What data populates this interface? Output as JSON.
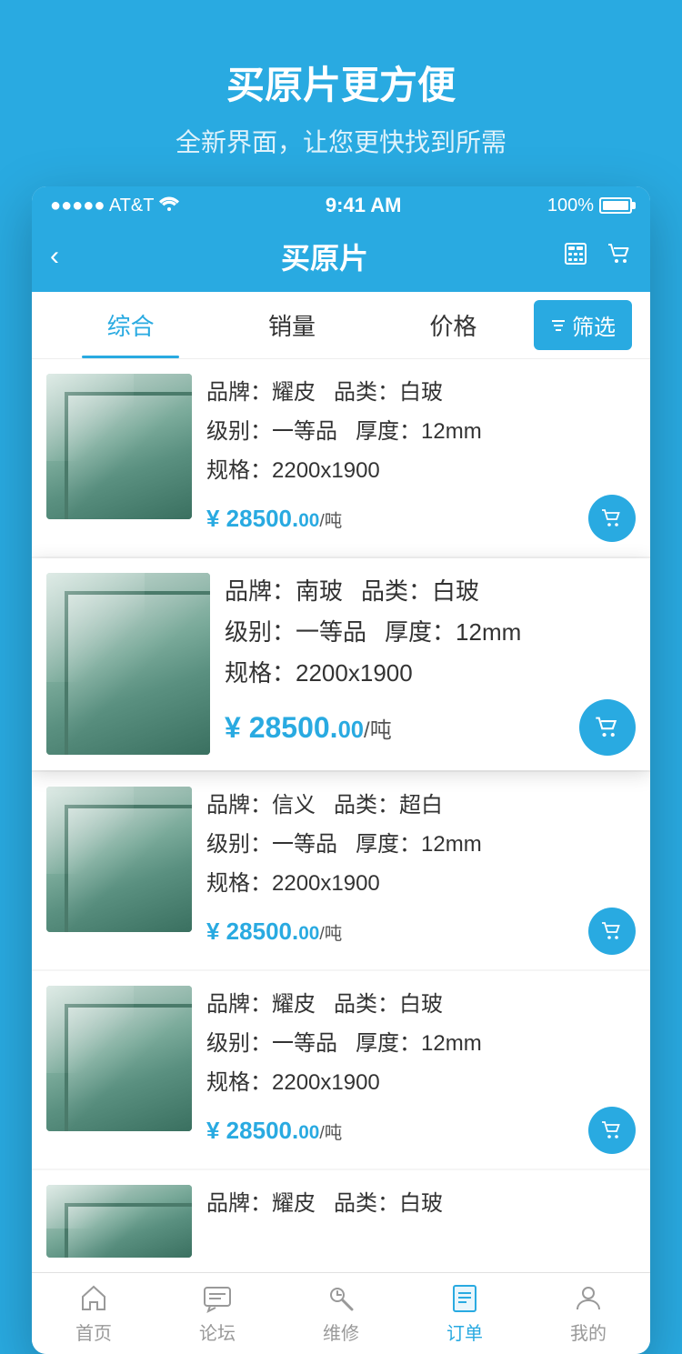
{
  "promo": {
    "title": "买原片更方便",
    "subtitle": "全新界面，让您更快找到所需"
  },
  "statusBar": {
    "carrier": "●●●●● AT&T",
    "wifi": "WiFi",
    "time": "9:41 AM",
    "battery": "100%"
  },
  "navBar": {
    "title": "买原片",
    "back": "‹"
  },
  "filterBar": {
    "tabs": [
      "综合",
      "销量",
      "价格"
    ],
    "activeTab": 0,
    "filterLabel": "筛选"
  },
  "products": [
    {
      "brand_label": "品牌：",
      "brand": "耀皮",
      "category_label": "品类：",
      "category": "白玻",
      "level_label": "级别：",
      "level": "一等品",
      "thickness_label": "厚度：",
      "thickness": "12mm",
      "spec_label": "规格：",
      "spec": "2200x1900",
      "price": "¥ 28500.",
      "price_decimal": "00",
      "price_unit": "/吨",
      "highlighted": false
    },
    {
      "brand_label": "品牌：",
      "brand": "南玻",
      "category_label": "品类：",
      "category": "白玻",
      "level_label": "级别：",
      "level": "一等品",
      "thickness_label": "厚度：",
      "thickness": "12mm",
      "spec_label": "规格：",
      "spec": "2200x1900",
      "price": "¥ 28500.",
      "price_decimal": "00",
      "price_unit": "/吨",
      "highlighted": true
    },
    {
      "brand_label": "品牌：",
      "brand": "信义",
      "category_label": "品类：",
      "category": "超白",
      "level_label": "级别：",
      "level": "一等品",
      "thickness_label": "厚度：",
      "thickness": "12mm",
      "spec_label": "规格：",
      "spec": "2200x1900",
      "price": "¥ 28500.",
      "price_decimal": "00",
      "price_unit": "/吨",
      "highlighted": false
    },
    {
      "brand_label": "品牌：",
      "brand": "耀皮",
      "category_label": "品类：",
      "category": "白玻",
      "level_label": "级别：",
      "level": "一等品",
      "thickness_label": "厚度：",
      "thickness": "12mm",
      "spec_label": "规格：",
      "spec": "2200x1900",
      "price": "¥ 28500.",
      "price_decimal": "00",
      "price_unit": "/吨",
      "highlighted": false
    },
    {
      "brand_label": "品牌：",
      "brand": "耀皮",
      "category_label": "品类：",
      "category": "白玻",
      "partial": true
    }
  ],
  "tabBar": {
    "items": [
      {
        "label": "首页",
        "active": false
      },
      {
        "label": "论坛",
        "active": false
      },
      {
        "label": "维修",
        "active": false
      },
      {
        "label": "订单",
        "active": true
      },
      {
        "label": "我的",
        "active": false
      }
    ]
  }
}
